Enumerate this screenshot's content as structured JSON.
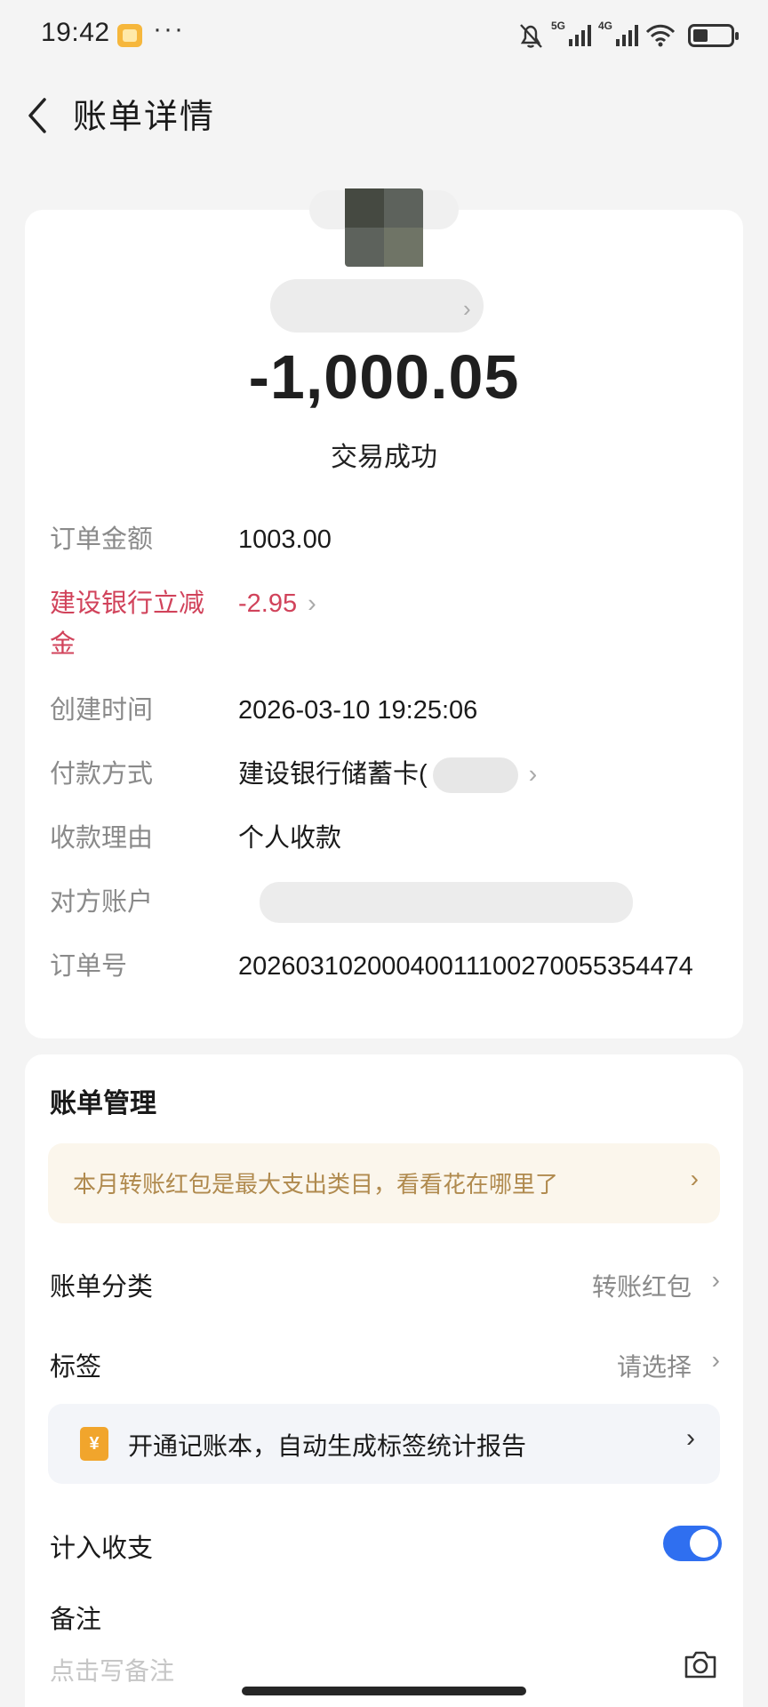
{
  "status_bar": {
    "time": "19:42",
    "dots": "···",
    "net_5g": "5G",
    "net_4g": "4G",
    "icons": [
      "mute-bell-icon",
      "signal-5g-icon",
      "signal-4g-icon",
      "wifi-icon",
      "battery-icon"
    ]
  },
  "header": {
    "title": "账单详情"
  },
  "detail": {
    "amount": "-1,000.05",
    "status": "交易成功",
    "rows": [
      {
        "label": "订单金额",
        "value": "1003.00"
      },
      {
        "label": "建设银行立减金",
        "value": "-2.95"
      },
      {
        "label": "创建时间",
        "value": "2026-03-10 19:25:06"
      },
      {
        "label": "付款方式",
        "value": "建设银行储蓄卡("
      },
      {
        "label": "收款理由",
        "value": "个人收款"
      },
      {
        "label": "对方账户",
        "value": ""
      },
      {
        "label": "订单号",
        "value": "20260310200040011100270055354474"
      }
    ],
    "accent_red": "#d1435b"
  },
  "manage": {
    "title": "账单管理",
    "promo": "本月转账红包是最大支出类目，看看花在哪里了",
    "category_label": "账单分类",
    "category_value": "转账红包",
    "tag_label": "标签",
    "tag_value": "请选择",
    "ledger_icon": "¥",
    "ledger_text": "开通记账本，自动生成标签统计报告",
    "count_label": "计入收支",
    "count_enabled": true,
    "remark_label": "备注",
    "remark_placeholder": "点击写备注",
    "toggle_color": "#2f6ff0"
  }
}
